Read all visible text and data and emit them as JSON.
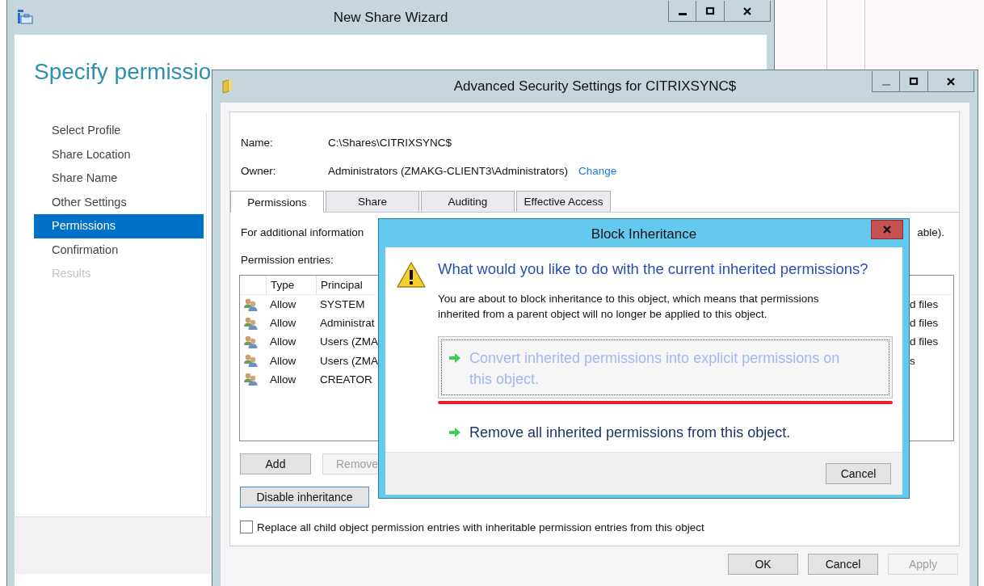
{
  "wizard": {
    "title": "New Share Wizard",
    "heading": "Specify permissio",
    "steps": [
      {
        "label": "Select Profile",
        "selected": false,
        "disabled": false
      },
      {
        "label": "Share Location",
        "selected": false,
        "disabled": false
      },
      {
        "label": "Share Name",
        "selected": false,
        "disabled": false
      },
      {
        "label": "Other Settings",
        "selected": false,
        "disabled": false
      },
      {
        "label": "Permissions",
        "selected": true,
        "disabled": false
      },
      {
        "label": "Confirmation",
        "selected": false,
        "disabled": false
      },
      {
        "label": "Results",
        "selected": false,
        "disabled": true
      }
    ]
  },
  "advanced": {
    "title": "Advanced Security Settings for CITRIXSYNC$",
    "name_label": "Name:",
    "name_value": "C:\\Shares\\CITRIXSYNC$",
    "owner_label": "Owner:",
    "owner_value": "Administrators (ZMAKG-CLIENT3\\Administrators)",
    "change_link": "Change",
    "tabs": [
      {
        "label": "Permissions",
        "selected": true
      },
      {
        "label": "Share",
        "selected": false
      },
      {
        "label": "Auditing",
        "selected": false
      },
      {
        "label": "Effective Access",
        "selected": false
      }
    ],
    "info_start": "For additional information",
    "info_end": "able).",
    "entries_label": "Permission entries:",
    "columns": [
      "Type",
      "Principal"
    ],
    "rows": [
      {
        "type": "Allow",
        "principal": "SYSTEM",
        "access": "d files"
      },
      {
        "type": "Allow",
        "principal": "Administrat",
        "access": "d files"
      },
      {
        "type": "Allow",
        "principal": "Users (ZMA",
        "access": "d files"
      },
      {
        "type": "Allow",
        "principal": "Users (ZMA",
        "access": "s"
      },
      {
        "type": "Allow",
        "principal": "CREATOR"
      }
    ],
    "buttons": [
      {
        "label": "Add",
        "disabled": false
      },
      {
        "label": "Remove",
        "disabled": true
      }
    ],
    "disable_inheritance": "Disable inheritance",
    "replace_checkbox": {
      "label": "Replace all child object permission entries with inheritable permission entries from this object",
      "checked": false
    },
    "footer_buttons": [
      {
        "label": "OK",
        "disabled": false
      },
      {
        "label": "Cancel",
        "disabled": false
      },
      {
        "label": "Apply",
        "disabled": true
      }
    ]
  },
  "dialog": {
    "title": "Block Inheritance",
    "question": "What would you like to do with the current inherited permissions?",
    "message": "You are about to block inheritance to this object, which means that permissions inherited from a parent object will no longer be applied to this object.",
    "options": [
      {
        "label": "Convert inherited permissions into explicit permissions on this object.",
        "selected": true,
        "underlined": true
      },
      {
        "label": "Remove all inherited permissions from this object.",
        "selected": false,
        "underlined": false
      }
    ],
    "cancel": "Cancel"
  }
}
